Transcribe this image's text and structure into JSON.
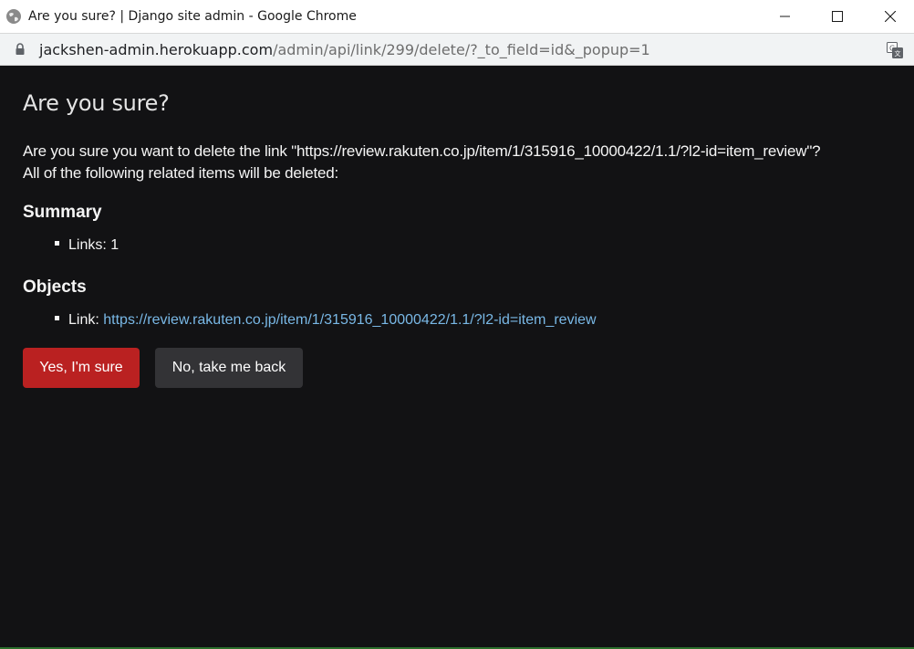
{
  "window": {
    "title": "Are you sure? | Django site admin - Google Chrome",
    "controls": [
      "minimize-icon",
      "maximize-icon",
      "close-icon"
    ]
  },
  "address_bar": {
    "url_host": "jackshen-admin.herokuapp.com",
    "url_path": "/admin/api/link/299/delete/?_to_field=id&_popup=1",
    "icons": [
      "lock-icon",
      "translate-icon"
    ]
  },
  "page": {
    "title": "Are you sure?",
    "confirm_line1": "Are you sure you want to delete the link \"https://review.rakuten.co.jp/item/1/315916_10000422/1.1/?l2-id=item_review\"?",
    "confirm_line2": "All of the following related items will be deleted:",
    "summary_heading": "Summary",
    "summary_items": [
      {
        "label": "Links: 1"
      }
    ],
    "objects_heading": "Objects",
    "object_items": [
      {
        "prefix": "Link: ",
        "link_text": "https://review.rakuten.co.jp/item/1/315916_10000422/1.1/?l2-id=item_review"
      }
    ],
    "confirm_button": "Yes, I'm sure",
    "cancel_button": "No, take me back"
  },
  "colors": {
    "background": "#121214",
    "danger_button": "#ba2121",
    "secondary_button": "#333336",
    "link": "#79b8e6"
  }
}
